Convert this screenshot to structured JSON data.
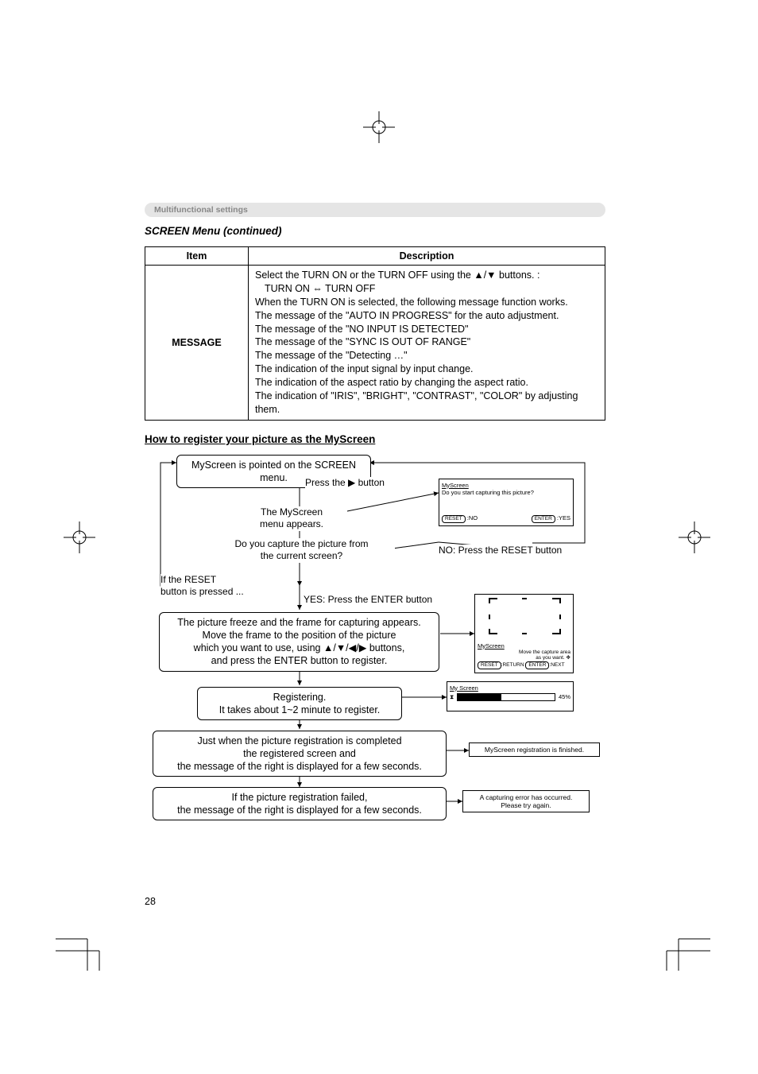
{
  "header": "Multifunctional settings",
  "subtitle": "SCREEN Menu (continued)",
  "table": {
    "head_item": "Item",
    "head_desc": "Description",
    "item": "MESSAGE",
    "desc_line1_a": "Select the TURN ON or the TURN OFF using the ",
    "desc_line1_b": " buttons. :",
    "desc_line2": "TURN ON ⇔ TURN OFF",
    "desc_line3": "When the TURN ON is selected, the following message function works.",
    "desc_line4": "The message of the \"AUTO IN PROGRESS\" for the auto adjustment.",
    "desc_line5": "The message of the \"NO INPUT IS DETECTED\"",
    "desc_line6": "The message of the \"SYNC IS OUT OF RANGE\"",
    "desc_line7": "The message of the \"Detecting …\"",
    "desc_line8": "The indication of the input signal by input change.",
    "desc_line9": "The indication of the aspect ratio by changing the aspect ratio.",
    "desc_line10": "The indication of \"IRIS\", \"BRIGHT\", \"CONTRAST\", \"COLOR\" by adjusting them."
  },
  "section_title": "How to register your picture as the MyScreen",
  "flow": {
    "b1": "MyScreen is pointed on the SCREEN menu.",
    "press_right": "Press the ▶ button",
    "l_myscreen1": "The MyScreen",
    "l_myscreen2": "menu appears.",
    "l_capture1": "Do you capture the picture from",
    "l_capture2": "the current screen?",
    "no_reset": "NO: Press the RESET button",
    "reset1": "If the RESET",
    "reset2": "button is pressed ...",
    "yes_enter": "YES: Press the ENTER button",
    "b2a": "The picture freeze and the frame for capturing appears.",
    "b2b": "Move the frame to the position of the picture",
    "b2c_a": "which you want to use, using ",
    "b2c_b": " buttons,",
    "b2d": "and press the ENTER button to register.",
    "b3a": "Registering.",
    "b3b": "It takes about 1~2 minute to register.",
    "b4a": "Just when the picture registration is completed",
    "b4b": "the registered screen and",
    "b4c": "the message of the right is displayed for a few seconds.",
    "b5a": "If the picture registration failed,",
    "b5b": "the message of the right is displayed for a few seconds.",
    "ui1_title": "MyScreen",
    "ui1_line": "Do you start capturing this picture?",
    "ui1_no": ":NO",
    "ui1_yes": ":YES",
    "ui1_btn_reset": "RESET",
    "ui1_btn_enter": "ENTER",
    "ui2_title": "MyScreen",
    "ui2_line1": "Move the capture area",
    "ui2_line2": "as you want.",
    "ui2_return": ":RETURN",
    "ui2_next": ":NEXT",
    "ui2_btn_reset": "RESET",
    "ui2_btn_enter": "ENTER",
    "ui3_title": "My Screen",
    "ui3_pct": "45%",
    "ui4": "MyScreen registration is finished.",
    "ui5a": "A capturing error has occurred.",
    "ui5b": "Please try again."
  },
  "pagenum": "28"
}
